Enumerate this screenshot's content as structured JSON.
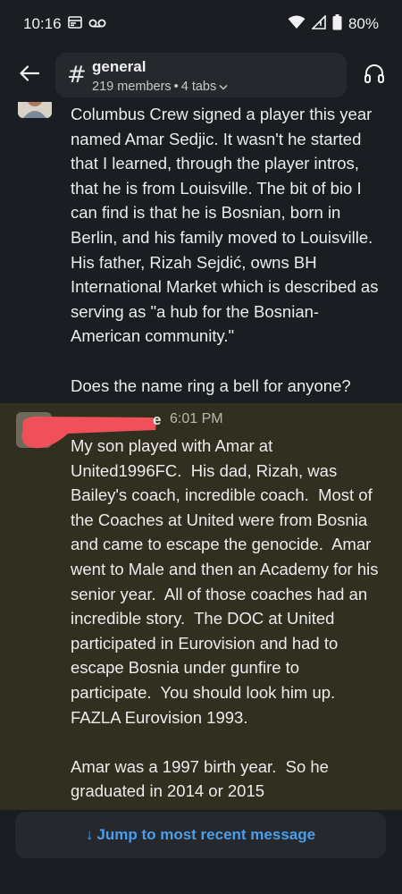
{
  "status_bar": {
    "time": "10:16",
    "battery": "80%",
    "icons": [
      "notification-card-icon",
      "voicemail-icon",
      "wifi-icon",
      "signal-icon",
      "battery-icon"
    ]
  },
  "header": {
    "hash": "#",
    "channel_name": "general",
    "members": "219 members",
    "separator": "•",
    "tabs": "4 tabs",
    "icons": [
      "back-arrow-icon",
      "chevron-down-icon",
      "headphones-icon"
    ]
  },
  "messages": [
    {
      "text": "Columbus Crew signed a player this year named Amar Sedjic. It wasn't he started that I learned, through the player intros, that he is from Louisville. The bit of bio I can find is that he is Bosnian, born in Berlin, and his family moved to Louisville. His father, Rizah Sejdić, owns BH International Market which is described as serving as \"a hub for the Bosnian-American community.\"\n\nDoes the name ring a bell for anyone?"
    },
    {
      "sender_visible": "e",
      "time": "6:01 PM",
      "text": "My son played with Amar at United1996FC.  His dad, Rizah, was Bailey's coach, incredible coach.  Most of the Coaches at United were from Bosnia and came to escape the genocide.  Amar went to Male and then an Academy for his senior year.  All of those coaches had an incredible story.  The DOC at United participated in Eurovision and had to escape Bosnia under gunfire to participate.  You should look him up.  FAZLA Eurovision 1993.\n\nAmar was a 1997 birth year.  So he graduated in 2014 or 2015"
    }
  ],
  "jump": {
    "arrow": "↓",
    "label": "Jump to most recent message"
  },
  "colors": {
    "background": "#1a1d21",
    "highlight": "#302f20",
    "link": "#4a9eea",
    "redaction": "#f0505a"
  }
}
